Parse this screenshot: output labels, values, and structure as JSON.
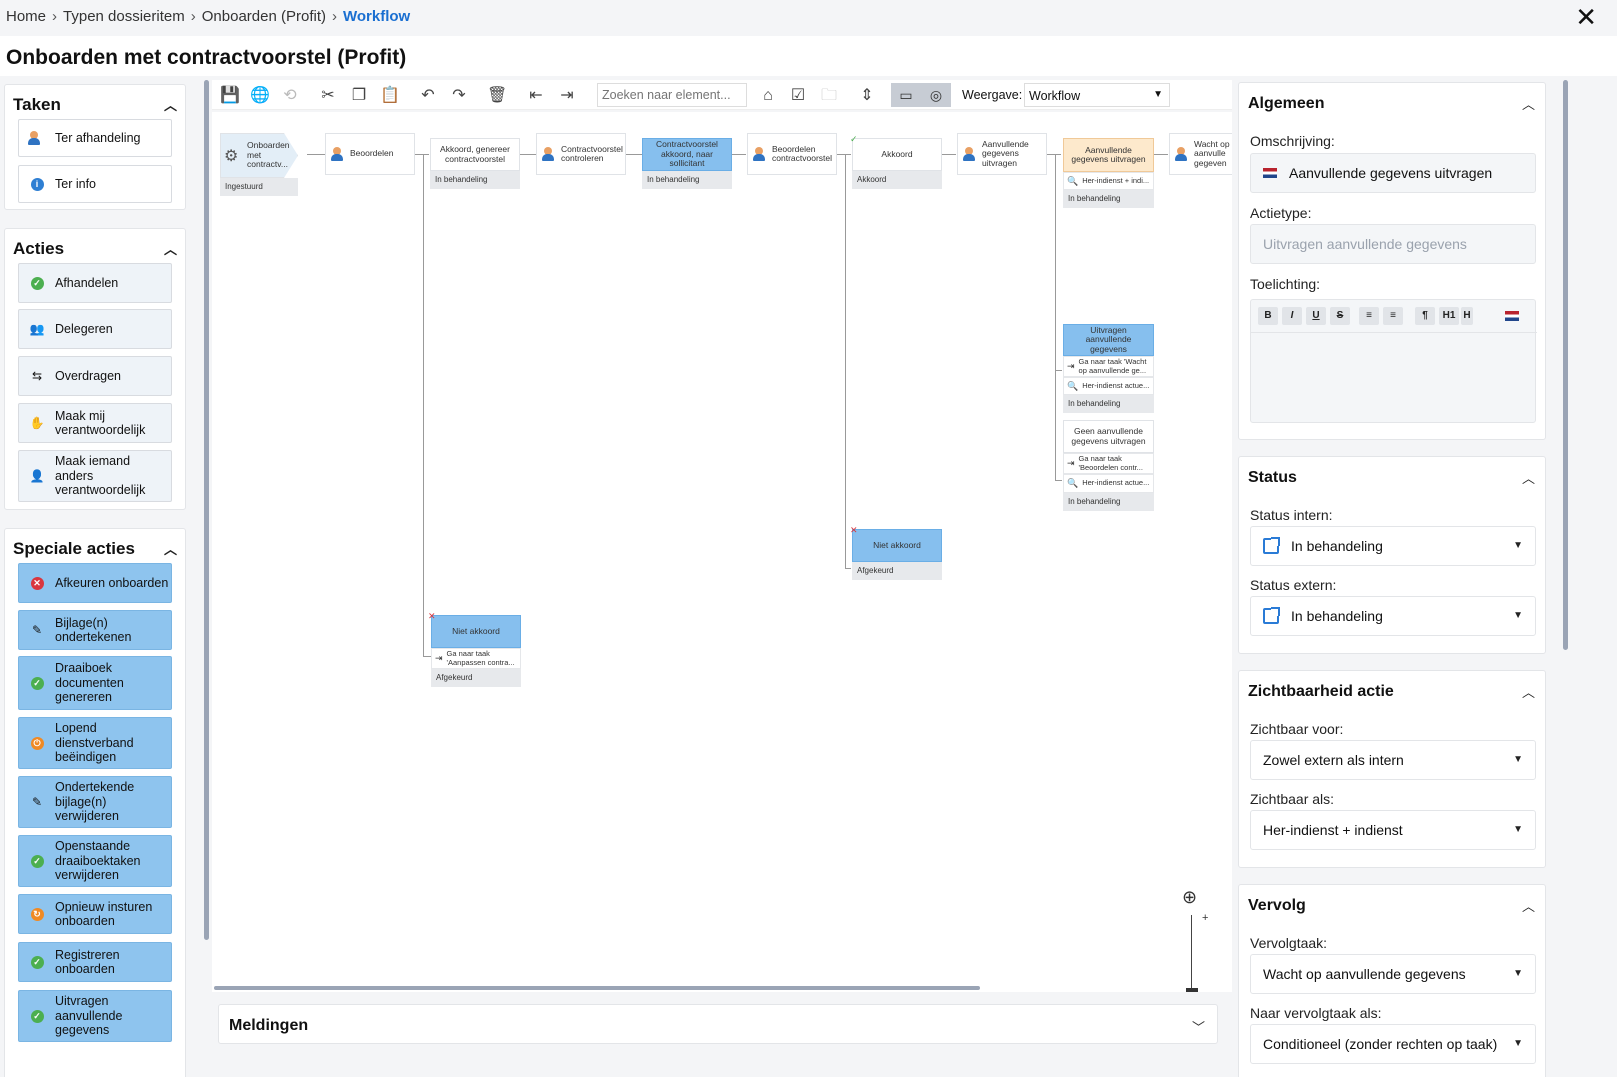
{
  "breadcrumb": {
    "items": [
      "Home",
      "Typen dossieritem",
      "Onboarden (Profit)"
    ],
    "current": "Workflow"
  },
  "page": {
    "title": "Onboarden met contractvoorstel (Profit)"
  },
  "taken": {
    "title": "Taken",
    "items": [
      {
        "label": "Ter afhandeling",
        "icon": "user-icon"
      },
      {
        "label": "Ter info",
        "icon": "info-icon"
      }
    ]
  },
  "acties": {
    "title": "Acties",
    "items": [
      {
        "label": "Afhandelen",
        "icon": "check-circle-icon"
      },
      {
        "label": "Delegeren",
        "icon": "delegate-icon"
      },
      {
        "label": "Overdragen",
        "icon": "transfer-icon"
      },
      {
        "label": "Maak mij verantwoordelijk",
        "icon": "responsible-me-icon"
      },
      {
        "label": "Maak iemand anders verantwoordelijk",
        "icon": "responsible-other-icon"
      }
    ]
  },
  "speciale_acties": {
    "title": "Speciale acties",
    "items": [
      {
        "label": "Afkeuren onboarden",
        "icon": "reject-icon"
      },
      {
        "label": "Bijlage(n) ondertekenen",
        "icon": "sign-icon"
      },
      {
        "label": "Draaiboek documenten genereren",
        "icon": "check-circle-icon"
      },
      {
        "label": "Lopend dienstverband beëindigen",
        "icon": "stop-icon"
      },
      {
        "label": "Ondertekende bijlage(n) verwijderen",
        "icon": "sign-icon"
      },
      {
        "label": "Openstaande draaiboektaken verwijderen",
        "icon": "check-circle-icon"
      },
      {
        "label": "Opnieuw insturen onboarden",
        "icon": "refresh-icon"
      },
      {
        "label": "Registreren onboarden",
        "icon": "check-circle-icon"
      },
      {
        "label": "Uitvragen aanvullende gegevens",
        "icon": "check-circle-icon"
      }
    ]
  },
  "toolbar": {
    "search_placeholder": "Zoeken naar element...",
    "view_label": "Weergave:",
    "view_value": "Workflow"
  },
  "workflow": {
    "nodes": [
      {
        "id": "n1",
        "title": "Onboarden met contractv...",
        "status": "Ingestuurd"
      },
      {
        "id": "n2",
        "title": "Beoordelen"
      },
      {
        "id": "n3",
        "title": "Akkoord, genereer contractvoorstel",
        "status": "In behandeling"
      },
      {
        "id": "n4",
        "title": "Contractvoorstel controleren"
      },
      {
        "id": "n5",
        "title": "Contractvoorstel akkoord, naar sollicitant",
        "status": "In behandeling"
      },
      {
        "id": "n6",
        "title": "Beoordelen contractvoorstel"
      },
      {
        "id": "n7",
        "title": "Akkoord",
        "status": "Akkoord"
      },
      {
        "id": "n8",
        "title": "Aanvullende gegevens uitvragen"
      },
      {
        "id": "n9",
        "title": "Aanvullende gegevens uitvragen",
        "row1": "Her-indienst + indi...",
        "status": "In behandeling"
      },
      {
        "id": "n10",
        "title": "Wacht op aanvulle gegeven"
      },
      {
        "id": "n11",
        "title": "Uitvragen aanvullende gegevens",
        "row1": "Ga naar taak 'Wacht op aanvullende ge...",
        "row2": "Her-indienst actue...",
        "status": "In behandeling"
      },
      {
        "id": "n12",
        "title": "Geen aanvullende gegevens uitvragen",
        "row1": "Ga naar taak 'Beoordelen contr...",
        "row2": "Her-indienst actue...",
        "status": "In behandeling"
      },
      {
        "id": "n13",
        "title": "Niet akkoord",
        "status": "Afgekeurd"
      },
      {
        "id": "n14",
        "title": "Niet akkoord",
        "row1": "Ga naar taak 'Aanpassen contra...",
        "status": "Afgekeurd"
      }
    ]
  },
  "meldingen": {
    "title": "Meldingen"
  },
  "algemeen": {
    "title": "Algemeen",
    "omschrijving_label": "Omschrijving:",
    "omschrijving_value": "Aanvullende gegevens uitvragen",
    "actietype_label": "Actietype:",
    "actietype_placeholder": "Uitvragen aanvullende gegevens",
    "toelichting_label": "Toelichting:",
    "editor_buttons": [
      "B",
      "I",
      "U",
      "S",
      "≡",
      "≡",
      "¶",
      "H1",
      "H"
    ]
  },
  "status": {
    "title": "Status",
    "intern_label": "Status intern:",
    "intern_value": "In behandeling",
    "extern_label": "Status extern:",
    "extern_value": "In behandeling"
  },
  "zichtbaarheid": {
    "title": "Zichtbaarheid actie",
    "voor_label": "Zichtbaar voor:",
    "voor_value": "Zowel extern als intern",
    "als_label": "Zichtbaar als:",
    "als_value": "Her-indienst + indienst"
  },
  "vervolg": {
    "title": "Vervolg",
    "taak_label": "Vervolgtaak:",
    "taak_value": "Wacht op aanvullende gegevens",
    "als_label": "Naar vervolgtaak als:",
    "als_value": "Conditioneel (zonder rechten op taak)"
  }
}
